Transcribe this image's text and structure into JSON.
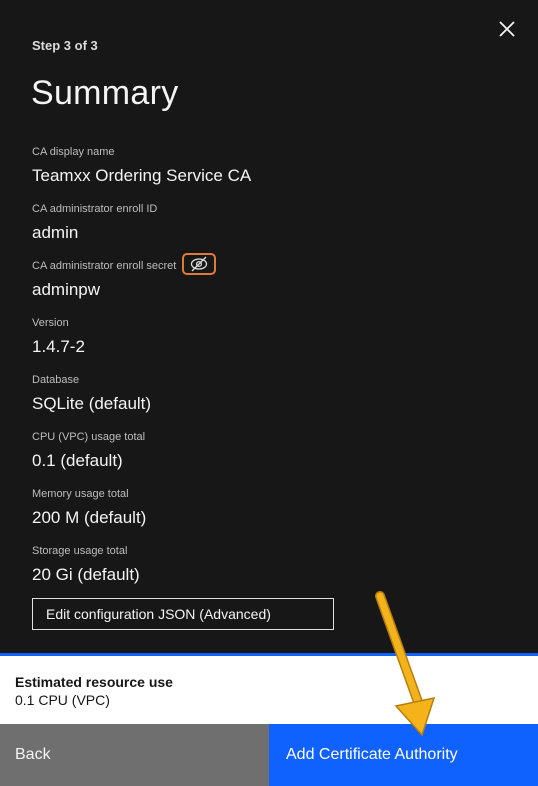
{
  "header": {
    "step": "Step 3 of 3",
    "title": "Summary"
  },
  "fields": {
    "display_name": {
      "label": "CA display name",
      "value": "Teamxx Ordering Service CA"
    },
    "enroll_id": {
      "label": "CA administrator enroll ID",
      "value": "admin"
    },
    "enroll_secret": {
      "label": "CA administrator enroll secret",
      "value": "adminpw"
    },
    "version": {
      "label": "Version",
      "value": "1.4.7-2"
    },
    "database": {
      "label": "Database",
      "value": "SQLite (default)"
    },
    "cpu": {
      "label": "CPU (VPC) usage total",
      "value": "0.1 (default)"
    },
    "memory": {
      "label": "Memory usage total",
      "value": "200 M (default)"
    },
    "storage": {
      "label": "Storage usage total",
      "value": "20 Gi (default)"
    }
  },
  "edit_json_label": "Edit configuration JSON (Advanced)",
  "resource": {
    "title": "Estimated resource use",
    "value": "0.1 CPU (VPC)"
  },
  "footer": {
    "back_label": "Back",
    "add_label": "Add Certificate Authority"
  },
  "icons": {
    "close": "close-icon",
    "visibility": "eye-off-icon",
    "annotation": "arrow-annotation"
  },
  "colors": {
    "panel_bg": "#171717",
    "primary": "#0f62fe",
    "secondary": "#6f6f6f",
    "highlight": "#e07a3a",
    "arrow": "#f5b31b"
  }
}
